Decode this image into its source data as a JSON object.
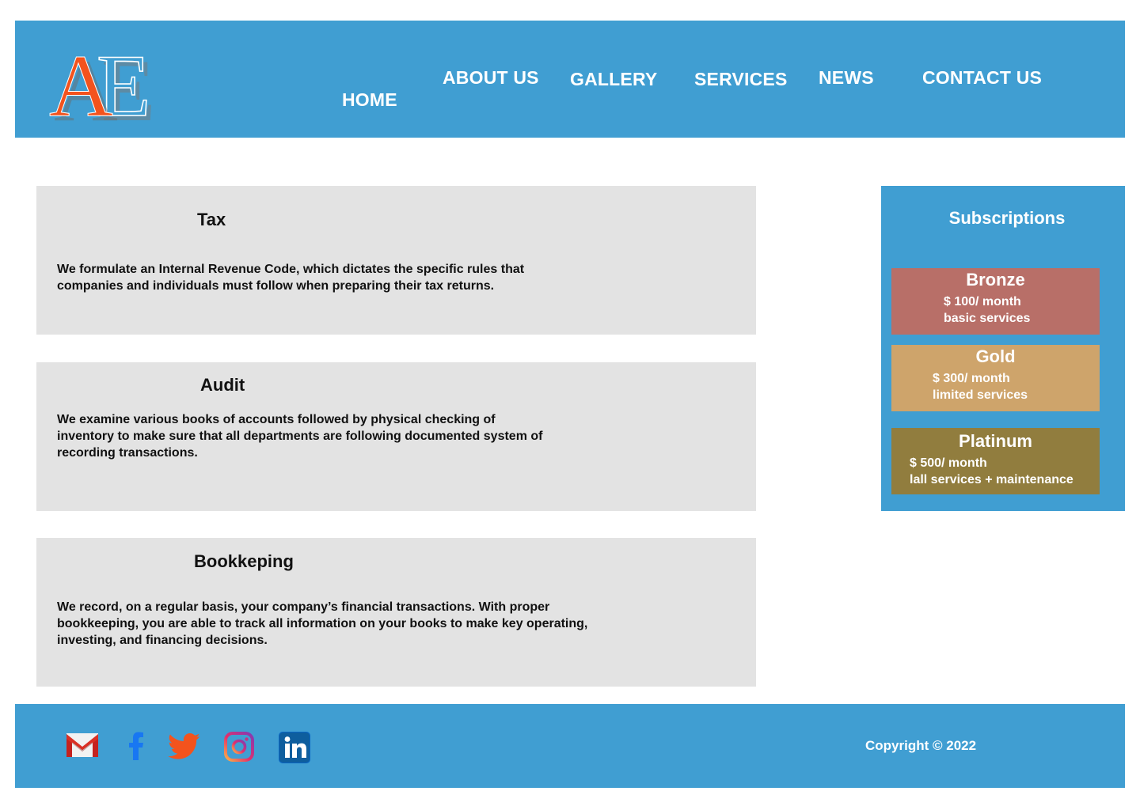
{
  "header": {
    "logo_text": "AE",
    "nav": {
      "home": "HOME",
      "about": "ABOUT US",
      "gallery": "GALLERY",
      "services": "SERVICES",
      "news": "NEWS",
      "contact": "CONTACT US"
    },
    "background": "#409ed2"
  },
  "services": [
    {
      "title": "Tax",
      "text": "We formulate an Internal Revenue Code, which dictates the specific rules that\ncompanies and individuals must follow when preparing their tax returns."
    },
    {
      "title": "Audit",
      "text": "We examine  various books of accounts followed by physical checking of\ninventory to make sure that all departments are following documented system of\nrecording transactions."
    },
    {
      "title": "Bookkeping",
      "text": " We record, on a regular basis, your company’s financial transactions. With proper\nbookkeeping, you are able to track all information on your books to make key operating,\ninvesting, and financing decisions."
    }
  ],
  "subscriptions": {
    "title": "Subscriptions",
    "plans": [
      {
        "name": "Bronze",
        "price": "$ 100/ month",
        "desc": "basic services",
        "color": "#b86f68"
      },
      {
        "name": "Gold",
        "price": "$ 300/ month",
        "desc": "limited services",
        "color": "#cea46b"
      },
      {
        "name": "Platinum",
        "price": "$ 500/ month",
        "desc": "lall services + maintenance",
        "color": "#917d3e"
      }
    ]
  },
  "footer": {
    "copyright": "Copyright © 2022",
    "social_icons": [
      "gmail-icon",
      "facebook-icon",
      "twitter-icon",
      "instagram-icon",
      "linkedin-icon"
    ]
  }
}
